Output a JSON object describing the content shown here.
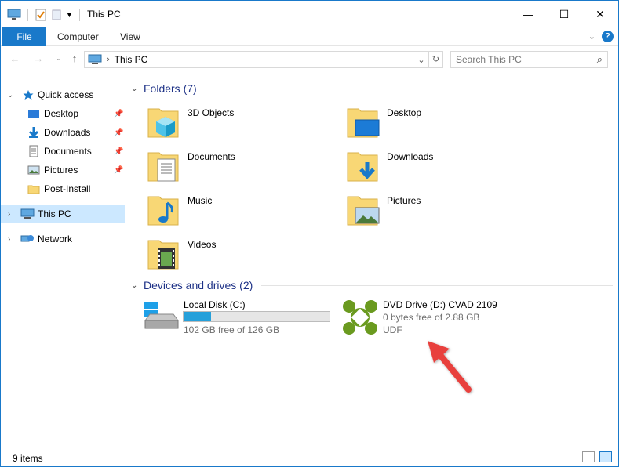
{
  "window": {
    "title": "This PC"
  },
  "ribbon": {
    "tabs": [
      "File",
      "Computer",
      "View"
    ]
  },
  "address": {
    "path": "This PC",
    "search_placeholder": "Search This PC"
  },
  "sidebar": {
    "items": [
      {
        "label": "Quick access",
        "icon": "star-icon"
      },
      {
        "label": "Desktop",
        "icon": "desktop-folder-icon",
        "pinned": true
      },
      {
        "label": "Downloads",
        "icon": "download-arrow-icon",
        "pinned": true
      },
      {
        "label": "Documents",
        "icon": "documents-icon",
        "pinned": true
      },
      {
        "label": "Pictures",
        "icon": "pictures-icon",
        "pinned": true
      },
      {
        "label": "Post-Install",
        "icon": "folder-icon"
      },
      {
        "label": "This PC",
        "icon": "computer-icon",
        "selected": true
      },
      {
        "label": "Network",
        "icon": "network-icon"
      }
    ]
  },
  "folders": {
    "header": "Folders (7)",
    "items": [
      {
        "label": "3D Objects",
        "icon": "3d-objects-icon"
      },
      {
        "label": "Desktop",
        "icon": "desktop-icon"
      },
      {
        "label": "Documents",
        "icon": "documents-icon"
      },
      {
        "label": "Downloads",
        "icon": "downloads-icon"
      },
      {
        "label": "Music",
        "icon": "music-icon"
      },
      {
        "label": "Pictures",
        "icon": "pictures-icon"
      },
      {
        "label": "Videos",
        "icon": "videos-icon"
      }
    ]
  },
  "drives": {
    "header": "Devices and drives (2)",
    "items": [
      {
        "name": "Local Disk (C:)",
        "free": "102 GB free of 126 GB",
        "used_fraction": 0.19,
        "icon": "windows-drive-icon"
      },
      {
        "name": "DVD Drive (D:) CVAD 2109",
        "free": "0 bytes free of 2.88 GB",
        "fs": "UDF",
        "icon": "citrix-dvd-icon"
      }
    ]
  },
  "status": {
    "items_count": "9 items"
  },
  "colors": {
    "accent": "#1979ca",
    "header": "#1e3287",
    "selection": "#cce8ff",
    "bar": "#26a0da",
    "arrow": "#e8403c"
  }
}
